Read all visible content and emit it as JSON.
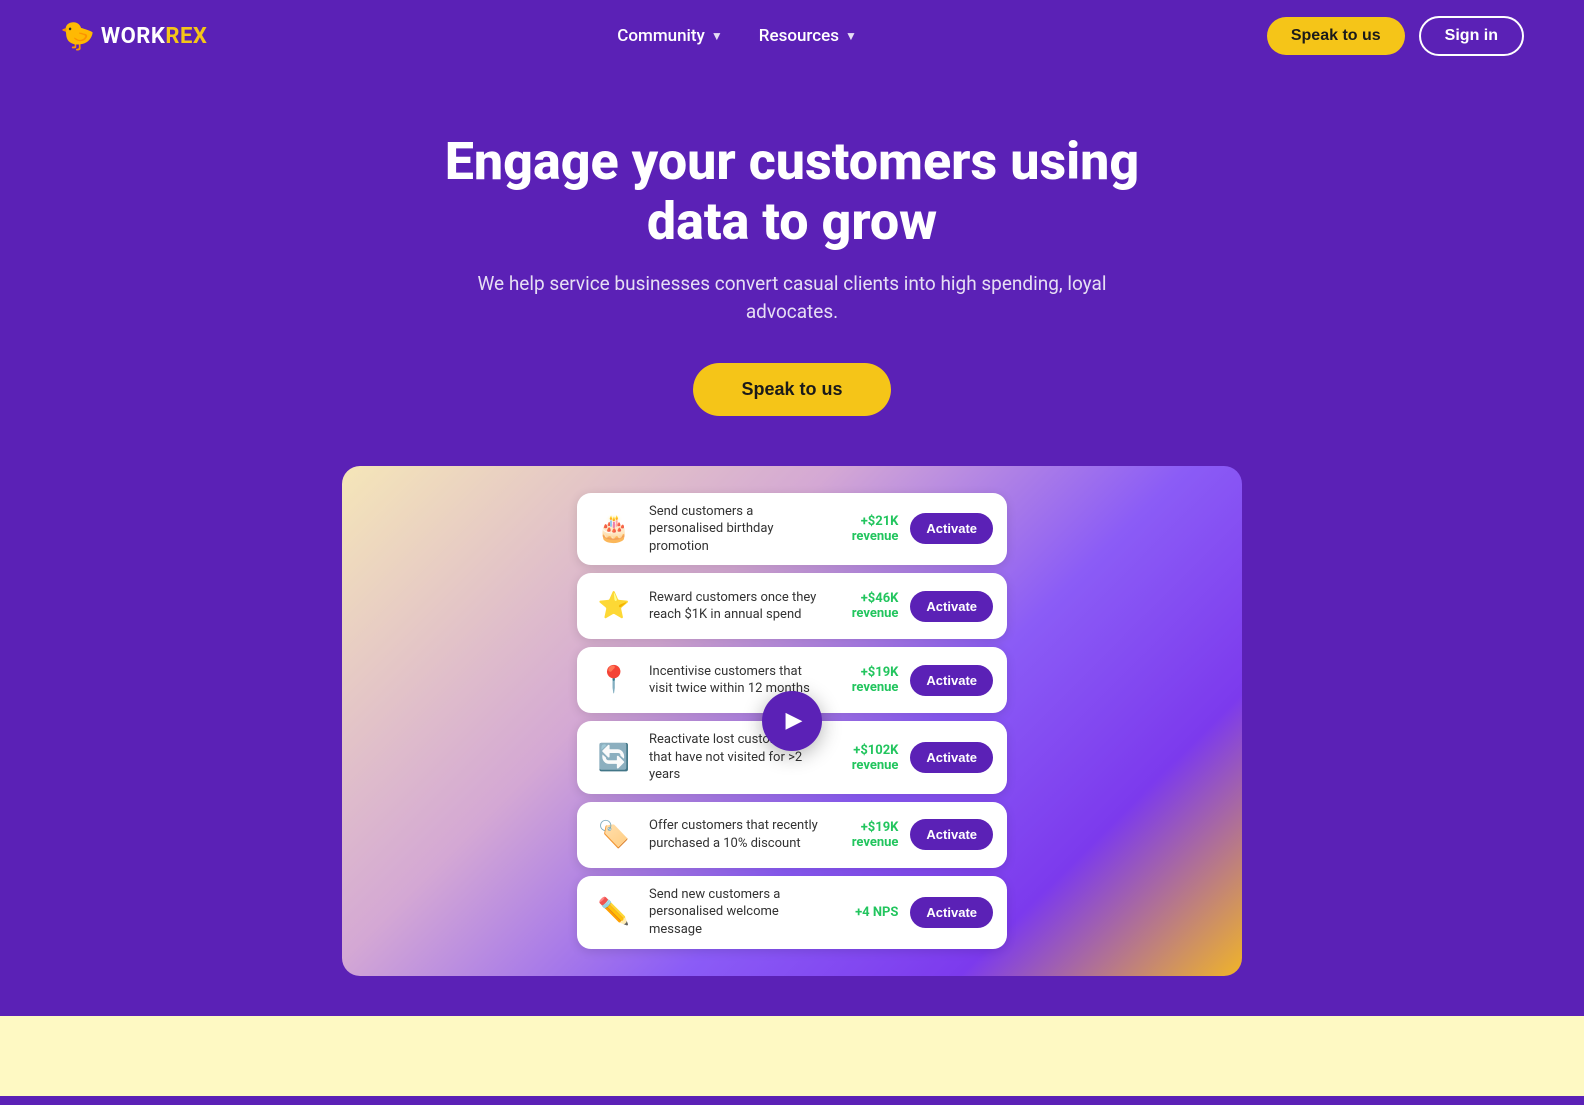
{
  "brand": {
    "logo_work": "WORK",
    "logo_rex": "REX",
    "bird_emoji": "🐦"
  },
  "nav": {
    "community_label": "Community",
    "resources_label": "Resources",
    "speak_label": "Speak to us",
    "signin_label": "Sign in"
  },
  "hero": {
    "headline": "Engage your customers using data to grow",
    "subtext": "We help service businesses convert casual clients into high spending, loyal advocates.",
    "cta_label": "Speak to us"
  },
  "cards": [
    {
      "icon": "🎂",
      "text": "Send customers a personalised birthday promotion",
      "revenue_value": "+$21K",
      "revenue_label": "revenue",
      "button_label": "Activate"
    },
    {
      "icon": "⭐",
      "text": "Reward customers once they reach $1K in annual spend",
      "revenue_value": "+$46K",
      "revenue_label": "revenue",
      "button_label": "Activate"
    },
    {
      "icon": "📍",
      "text": "Incentivise customers that visit twice within 12 months",
      "revenue_value": "+$19K",
      "revenue_label": "revenue",
      "button_label": "Activate"
    },
    {
      "icon": "🔄",
      "text": "Reactivate lost customers that have not visited for >2 years",
      "revenue_value": "+$102K",
      "revenue_label": "revenue",
      "button_label": "Activate"
    },
    {
      "icon": "🏷️",
      "text": "Offer customers that recently purchased a 10% discount",
      "revenue_value": "+$19K",
      "revenue_label": "revenue",
      "button_label": "Activate"
    },
    {
      "icon": "✏️",
      "text": "Send new customers a personalised welcome message",
      "revenue_value": "+4 NPS",
      "revenue_label": "",
      "button_label": "Activate"
    }
  ]
}
